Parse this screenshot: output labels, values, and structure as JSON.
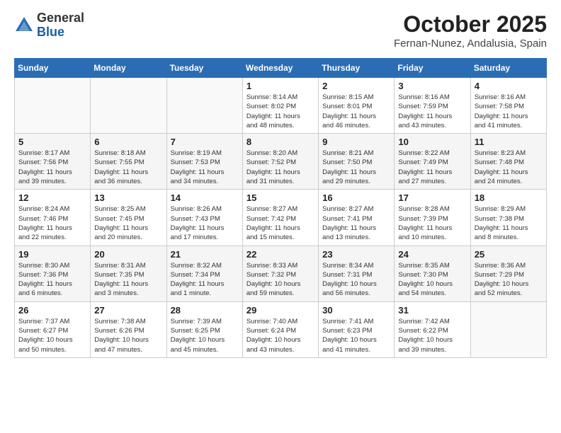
{
  "header": {
    "logo_general": "General",
    "logo_blue": "Blue",
    "month_title": "October 2025",
    "location": "Fernan-Nunez, Andalusia, Spain"
  },
  "weekdays": [
    "Sunday",
    "Monday",
    "Tuesday",
    "Wednesday",
    "Thursday",
    "Friday",
    "Saturday"
  ],
  "weeks": [
    [
      {
        "day": "",
        "info": ""
      },
      {
        "day": "",
        "info": ""
      },
      {
        "day": "",
        "info": ""
      },
      {
        "day": "1",
        "info": "Sunrise: 8:14 AM\nSunset: 8:02 PM\nDaylight: 11 hours\nand 48 minutes."
      },
      {
        "day": "2",
        "info": "Sunrise: 8:15 AM\nSunset: 8:01 PM\nDaylight: 11 hours\nand 46 minutes."
      },
      {
        "day": "3",
        "info": "Sunrise: 8:16 AM\nSunset: 7:59 PM\nDaylight: 11 hours\nand 43 minutes."
      },
      {
        "day": "4",
        "info": "Sunrise: 8:16 AM\nSunset: 7:58 PM\nDaylight: 11 hours\nand 41 minutes."
      }
    ],
    [
      {
        "day": "5",
        "info": "Sunrise: 8:17 AM\nSunset: 7:56 PM\nDaylight: 11 hours\nand 39 minutes."
      },
      {
        "day": "6",
        "info": "Sunrise: 8:18 AM\nSunset: 7:55 PM\nDaylight: 11 hours\nand 36 minutes."
      },
      {
        "day": "7",
        "info": "Sunrise: 8:19 AM\nSunset: 7:53 PM\nDaylight: 11 hours\nand 34 minutes."
      },
      {
        "day": "8",
        "info": "Sunrise: 8:20 AM\nSunset: 7:52 PM\nDaylight: 11 hours\nand 31 minutes."
      },
      {
        "day": "9",
        "info": "Sunrise: 8:21 AM\nSunset: 7:50 PM\nDaylight: 11 hours\nand 29 minutes."
      },
      {
        "day": "10",
        "info": "Sunrise: 8:22 AM\nSunset: 7:49 PM\nDaylight: 11 hours\nand 27 minutes."
      },
      {
        "day": "11",
        "info": "Sunrise: 8:23 AM\nSunset: 7:48 PM\nDaylight: 11 hours\nand 24 minutes."
      }
    ],
    [
      {
        "day": "12",
        "info": "Sunrise: 8:24 AM\nSunset: 7:46 PM\nDaylight: 11 hours\nand 22 minutes."
      },
      {
        "day": "13",
        "info": "Sunrise: 8:25 AM\nSunset: 7:45 PM\nDaylight: 11 hours\nand 20 minutes."
      },
      {
        "day": "14",
        "info": "Sunrise: 8:26 AM\nSunset: 7:43 PM\nDaylight: 11 hours\nand 17 minutes."
      },
      {
        "day": "15",
        "info": "Sunrise: 8:27 AM\nSunset: 7:42 PM\nDaylight: 11 hours\nand 15 minutes."
      },
      {
        "day": "16",
        "info": "Sunrise: 8:27 AM\nSunset: 7:41 PM\nDaylight: 11 hours\nand 13 minutes."
      },
      {
        "day": "17",
        "info": "Sunrise: 8:28 AM\nSunset: 7:39 PM\nDaylight: 11 hours\nand 10 minutes."
      },
      {
        "day": "18",
        "info": "Sunrise: 8:29 AM\nSunset: 7:38 PM\nDaylight: 11 hours\nand 8 minutes."
      }
    ],
    [
      {
        "day": "19",
        "info": "Sunrise: 8:30 AM\nSunset: 7:36 PM\nDaylight: 11 hours\nand 6 minutes."
      },
      {
        "day": "20",
        "info": "Sunrise: 8:31 AM\nSunset: 7:35 PM\nDaylight: 11 hours\nand 3 minutes."
      },
      {
        "day": "21",
        "info": "Sunrise: 8:32 AM\nSunset: 7:34 PM\nDaylight: 11 hours\nand 1 minute."
      },
      {
        "day": "22",
        "info": "Sunrise: 8:33 AM\nSunset: 7:32 PM\nDaylight: 10 hours\nand 59 minutes."
      },
      {
        "day": "23",
        "info": "Sunrise: 8:34 AM\nSunset: 7:31 PM\nDaylight: 10 hours\nand 56 minutes."
      },
      {
        "day": "24",
        "info": "Sunrise: 8:35 AM\nSunset: 7:30 PM\nDaylight: 10 hours\nand 54 minutes."
      },
      {
        "day": "25",
        "info": "Sunrise: 8:36 AM\nSunset: 7:29 PM\nDaylight: 10 hours\nand 52 minutes."
      }
    ],
    [
      {
        "day": "26",
        "info": "Sunrise: 7:37 AM\nSunset: 6:27 PM\nDaylight: 10 hours\nand 50 minutes."
      },
      {
        "day": "27",
        "info": "Sunrise: 7:38 AM\nSunset: 6:26 PM\nDaylight: 10 hours\nand 47 minutes."
      },
      {
        "day": "28",
        "info": "Sunrise: 7:39 AM\nSunset: 6:25 PM\nDaylight: 10 hours\nand 45 minutes."
      },
      {
        "day": "29",
        "info": "Sunrise: 7:40 AM\nSunset: 6:24 PM\nDaylight: 10 hours\nand 43 minutes."
      },
      {
        "day": "30",
        "info": "Sunrise: 7:41 AM\nSunset: 6:23 PM\nDaylight: 10 hours\nand 41 minutes."
      },
      {
        "day": "31",
        "info": "Sunrise: 7:42 AM\nSunset: 6:22 PM\nDaylight: 10 hours\nand 39 minutes."
      },
      {
        "day": "",
        "info": ""
      }
    ]
  ]
}
